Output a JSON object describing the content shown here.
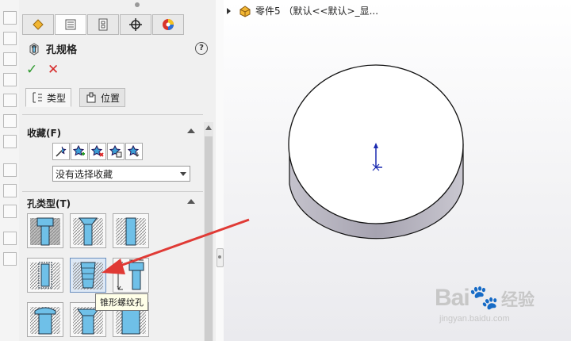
{
  "panel": {
    "title": "孔规格",
    "help": "?",
    "ok": "✓",
    "cancel": "✕",
    "tabs": [
      {
        "label": "类型"
      },
      {
        "label": "位置"
      }
    ]
  },
  "favorites": {
    "heading": "收藏(F)",
    "select_value": "没有选择收藏"
  },
  "hole_type": {
    "heading": "孔类型(T)",
    "tooltip": "锥形螺纹孔"
  },
  "viewport": {
    "tree_label": "零件5 （默认<<默认>_显..."
  },
  "watermark": {
    "brand": "Bai",
    "brand2": "经验",
    "url": "jingyan.baidu.com"
  },
  "colors": {
    "hole_blue": "#6fc0e8",
    "arrow_red": "#e03a35",
    "triad_blue": "#1a2ab0"
  }
}
